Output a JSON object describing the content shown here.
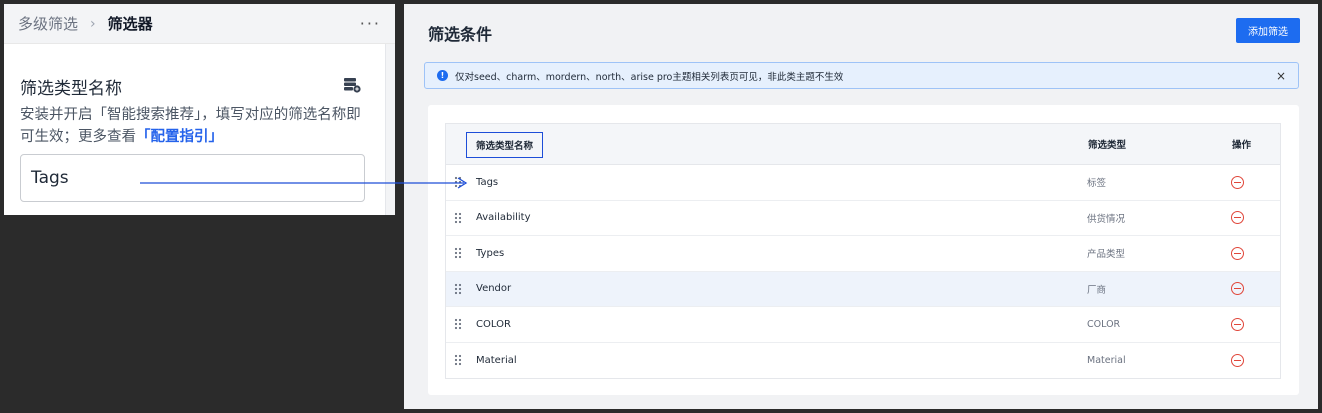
{
  "left_panel": {
    "breadcrumb": [
      "多级筛选",
      "筛选器"
    ],
    "breadcrumb_sep": "›",
    "more": "···",
    "field_title": "筛选类型名称",
    "description_prefix": "安装并开启「智能搜索推荐」，填写对应的筛选名称即可生效；更多查看",
    "description_link": "「配置指引」",
    "input_value": "Tags",
    "icons": [
      "database-add-icon",
      "drag-icon"
    ]
  },
  "right_panel": {
    "title": "筛选条件",
    "add_button": "添加筛选",
    "notice": {
      "icon": "!",
      "text": "仅对seed、charm、mordern、north、arise pro主题相关列表页可见，非此类主题不生效",
      "close": "×"
    },
    "table": {
      "headers": {
        "name": "筛选类型名称",
        "type": "筛选类型",
        "op": "操作"
      },
      "rows": [
        {
          "name": "Tags",
          "type": "标签"
        },
        {
          "name": "Availability",
          "type": "供货情况"
        },
        {
          "name": "Types",
          "type": "产品类型"
        },
        {
          "name": "Vendor",
          "type": "厂商"
        },
        {
          "name": "COLOR",
          "type": "COLOR"
        },
        {
          "name": "Material",
          "type": "Material"
        }
      ]
    }
  },
  "colors": {
    "primary": "#1d6cf0",
    "danger": "#e0463a",
    "annotation": "#1d4ed8"
  }
}
